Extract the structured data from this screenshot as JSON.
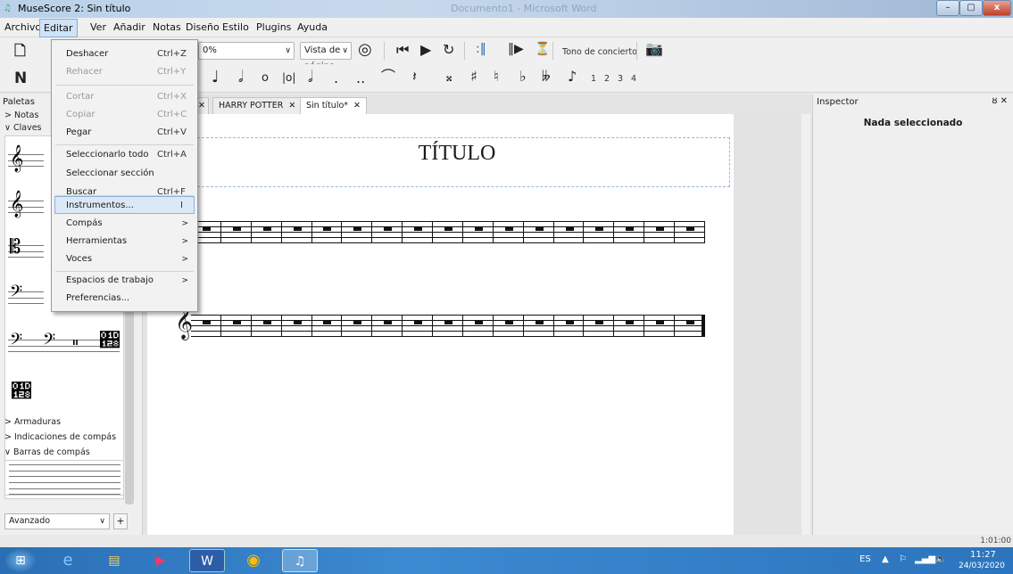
{
  "window": {
    "title": "MuseScore 2: Sin título",
    "background_title": "Documento1 - Microsoft Word",
    "controls": {
      "minimize": "–",
      "maximize": "▢",
      "close": "x"
    }
  },
  "menubar": {
    "items": [
      "Archivo",
      "Editar",
      "Ver",
      "Añadir",
      "Notas",
      "Diseño",
      "Estilo",
      "Plugins",
      "Ayuda"
    ],
    "active": "Editar"
  },
  "toolbar1": {
    "zoom_value": "0%",
    "view_mode": "Vista de página",
    "concert_pitch": "Tono de concierto"
  },
  "toolbar2": {
    "voices": [
      "1",
      "2",
      "3",
      "4"
    ]
  },
  "edit_menu": {
    "items": [
      {
        "label": "Deshacer",
        "shortcut": "Ctrl+Z",
        "disabled": false
      },
      {
        "label": "Rehacer",
        "shortcut": "Ctrl+Y",
        "disabled": true
      },
      {
        "label": "Cortar",
        "shortcut": "Ctrl+X",
        "disabled": true
      },
      {
        "label": "Copiar",
        "shortcut": "Ctrl+C",
        "disabled": true
      },
      {
        "label": "Pegar",
        "shortcut": "Ctrl+V",
        "disabled": false
      },
      {
        "label": "Seleccionarlo todo",
        "shortcut": "Ctrl+A",
        "disabled": false
      },
      {
        "label": "Seleccionar sección",
        "shortcut": "",
        "disabled": false
      },
      {
        "label": "Buscar",
        "shortcut": "Ctrl+F",
        "disabled": false
      },
      {
        "label": "Instrumentos...",
        "shortcut": "I",
        "disabled": false,
        "highlighted": true
      },
      {
        "label": "Compás",
        "submenu": true
      },
      {
        "label": "Herramientas",
        "submenu": true
      },
      {
        "label": "Voces",
        "submenu": true
      },
      {
        "label": "Espacios de trabajo",
        "submenu": true
      },
      {
        "label": "Preferencias...",
        "submenu": false
      }
    ]
  },
  "palettes": {
    "title": "Paletas",
    "sections": {
      "notas": "> Notas",
      "claves": "∨ Claves",
      "armaduras": "> Armaduras",
      "indicaciones": "> Indicaciones de compás",
      "barras": "∨ Barras de compás"
    },
    "workspace": "Avanzado",
    "add_button": "+"
  },
  "tabs": [
    {
      "label": "HARRY POTTER",
      "close": "✕"
    },
    {
      "label": "Sin título*",
      "close": "✕",
      "active": true
    }
  ],
  "score": {
    "title": "TÍTULO"
  },
  "inspector": {
    "title": "Inspector",
    "controls": "ȣ ✕",
    "empty_message": "Nada seleccionado"
  },
  "statusbar": {
    "time": "1:01:00"
  },
  "taskbar": {
    "language": "ES",
    "time": "11:27",
    "date": "24/03/2020"
  },
  "colors": {
    "menu_highlight": "#dbe8f6",
    "taskbar": "#2c74bd",
    "page": "#ffffff"
  }
}
